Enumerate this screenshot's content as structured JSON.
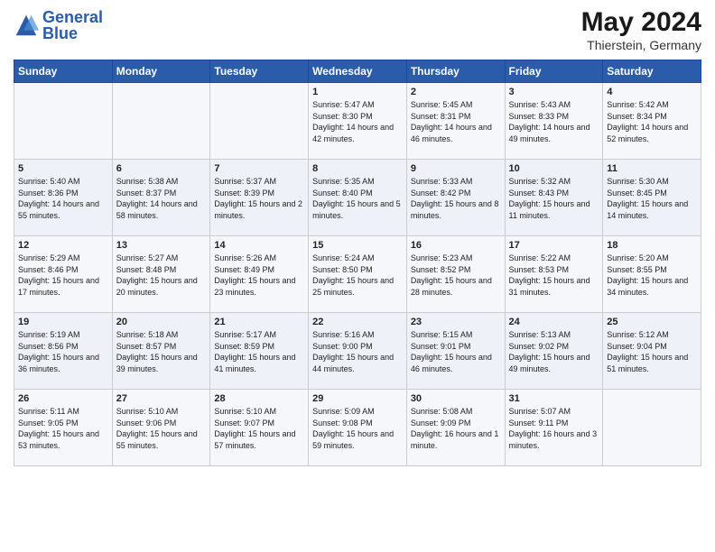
{
  "logo": {
    "text_general": "General",
    "text_blue": "Blue"
  },
  "header": {
    "month_year": "May 2024",
    "location": "Thierstein, Germany"
  },
  "days_of_week": [
    "Sunday",
    "Monday",
    "Tuesday",
    "Wednesday",
    "Thursday",
    "Friday",
    "Saturday"
  ],
  "weeks": [
    [
      {
        "day": "",
        "sunrise": "",
        "sunset": "",
        "daylight": ""
      },
      {
        "day": "",
        "sunrise": "",
        "sunset": "",
        "daylight": ""
      },
      {
        "day": "",
        "sunrise": "",
        "sunset": "",
        "daylight": ""
      },
      {
        "day": "1",
        "sunrise": "Sunrise: 5:47 AM",
        "sunset": "Sunset: 8:30 PM",
        "daylight": "Daylight: 14 hours and 42 minutes."
      },
      {
        "day": "2",
        "sunrise": "Sunrise: 5:45 AM",
        "sunset": "Sunset: 8:31 PM",
        "daylight": "Daylight: 14 hours and 46 minutes."
      },
      {
        "day": "3",
        "sunrise": "Sunrise: 5:43 AM",
        "sunset": "Sunset: 8:33 PM",
        "daylight": "Daylight: 14 hours and 49 minutes."
      },
      {
        "day": "4",
        "sunrise": "Sunrise: 5:42 AM",
        "sunset": "Sunset: 8:34 PM",
        "daylight": "Daylight: 14 hours and 52 minutes."
      }
    ],
    [
      {
        "day": "5",
        "sunrise": "Sunrise: 5:40 AM",
        "sunset": "Sunset: 8:36 PM",
        "daylight": "Daylight: 14 hours and 55 minutes."
      },
      {
        "day": "6",
        "sunrise": "Sunrise: 5:38 AM",
        "sunset": "Sunset: 8:37 PM",
        "daylight": "Daylight: 14 hours and 58 minutes."
      },
      {
        "day": "7",
        "sunrise": "Sunrise: 5:37 AM",
        "sunset": "Sunset: 8:39 PM",
        "daylight": "Daylight: 15 hours and 2 minutes."
      },
      {
        "day": "8",
        "sunrise": "Sunrise: 5:35 AM",
        "sunset": "Sunset: 8:40 PM",
        "daylight": "Daylight: 15 hours and 5 minutes."
      },
      {
        "day": "9",
        "sunrise": "Sunrise: 5:33 AM",
        "sunset": "Sunset: 8:42 PM",
        "daylight": "Daylight: 15 hours and 8 minutes."
      },
      {
        "day": "10",
        "sunrise": "Sunrise: 5:32 AM",
        "sunset": "Sunset: 8:43 PM",
        "daylight": "Daylight: 15 hours and 11 minutes."
      },
      {
        "day": "11",
        "sunrise": "Sunrise: 5:30 AM",
        "sunset": "Sunset: 8:45 PM",
        "daylight": "Daylight: 15 hours and 14 minutes."
      }
    ],
    [
      {
        "day": "12",
        "sunrise": "Sunrise: 5:29 AM",
        "sunset": "Sunset: 8:46 PM",
        "daylight": "Daylight: 15 hours and 17 minutes."
      },
      {
        "day": "13",
        "sunrise": "Sunrise: 5:27 AM",
        "sunset": "Sunset: 8:48 PM",
        "daylight": "Daylight: 15 hours and 20 minutes."
      },
      {
        "day": "14",
        "sunrise": "Sunrise: 5:26 AM",
        "sunset": "Sunset: 8:49 PM",
        "daylight": "Daylight: 15 hours and 23 minutes."
      },
      {
        "day": "15",
        "sunrise": "Sunrise: 5:24 AM",
        "sunset": "Sunset: 8:50 PM",
        "daylight": "Daylight: 15 hours and 25 minutes."
      },
      {
        "day": "16",
        "sunrise": "Sunrise: 5:23 AM",
        "sunset": "Sunset: 8:52 PM",
        "daylight": "Daylight: 15 hours and 28 minutes."
      },
      {
        "day": "17",
        "sunrise": "Sunrise: 5:22 AM",
        "sunset": "Sunset: 8:53 PM",
        "daylight": "Daylight: 15 hours and 31 minutes."
      },
      {
        "day": "18",
        "sunrise": "Sunrise: 5:20 AM",
        "sunset": "Sunset: 8:55 PM",
        "daylight": "Daylight: 15 hours and 34 minutes."
      }
    ],
    [
      {
        "day": "19",
        "sunrise": "Sunrise: 5:19 AM",
        "sunset": "Sunset: 8:56 PM",
        "daylight": "Daylight: 15 hours and 36 minutes."
      },
      {
        "day": "20",
        "sunrise": "Sunrise: 5:18 AM",
        "sunset": "Sunset: 8:57 PM",
        "daylight": "Daylight: 15 hours and 39 minutes."
      },
      {
        "day": "21",
        "sunrise": "Sunrise: 5:17 AM",
        "sunset": "Sunset: 8:59 PM",
        "daylight": "Daylight: 15 hours and 41 minutes."
      },
      {
        "day": "22",
        "sunrise": "Sunrise: 5:16 AM",
        "sunset": "Sunset: 9:00 PM",
        "daylight": "Daylight: 15 hours and 44 minutes."
      },
      {
        "day": "23",
        "sunrise": "Sunrise: 5:15 AM",
        "sunset": "Sunset: 9:01 PM",
        "daylight": "Daylight: 15 hours and 46 minutes."
      },
      {
        "day": "24",
        "sunrise": "Sunrise: 5:13 AM",
        "sunset": "Sunset: 9:02 PM",
        "daylight": "Daylight: 15 hours and 49 minutes."
      },
      {
        "day": "25",
        "sunrise": "Sunrise: 5:12 AM",
        "sunset": "Sunset: 9:04 PM",
        "daylight": "Daylight: 15 hours and 51 minutes."
      }
    ],
    [
      {
        "day": "26",
        "sunrise": "Sunrise: 5:11 AM",
        "sunset": "Sunset: 9:05 PM",
        "daylight": "Daylight: 15 hours and 53 minutes."
      },
      {
        "day": "27",
        "sunrise": "Sunrise: 5:10 AM",
        "sunset": "Sunset: 9:06 PM",
        "daylight": "Daylight: 15 hours and 55 minutes."
      },
      {
        "day": "28",
        "sunrise": "Sunrise: 5:10 AM",
        "sunset": "Sunset: 9:07 PM",
        "daylight": "Daylight: 15 hours and 57 minutes."
      },
      {
        "day": "29",
        "sunrise": "Sunrise: 5:09 AM",
        "sunset": "Sunset: 9:08 PM",
        "daylight": "Daylight: 15 hours and 59 minutes."
      },
      {
        "day": "30",
        "sunrise": "Sunrise: 5:08 AM",
        "sunset": "Sunset: 9:09 PM",
        "daylight": "Daylight: 16 hours and 1 minute."
      },
      {
        "day": "31",
        "sunrise": "Sunrise: 5:07 AM",
        "sunset": "Sunset: 9:11 PM",
        "daylight": "Daylight: 16 hours and 3 minutes."
      },
      {
        "day": "",
        "sunrise": "",
        "sunset": "",
        "daylight": ""
      }
    ]
  ]
}
